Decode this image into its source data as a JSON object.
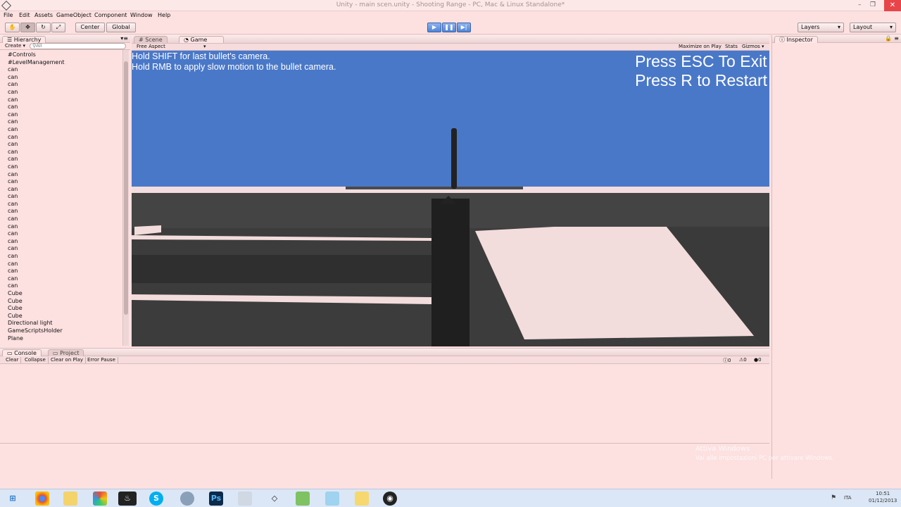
{
  "window": {
    "title": "Unity - main scen.unity - Shooting Range - PC, Mac & Linux Standalone*",
    "minimize": "–",
    "maximize": "❐",
    "close": "✕"
  },
  "menu": [
    "File",
    "Edit",
    "Assets",
    "GameObject",
    "Component",
    "Window",
    "Help"
  ],
  "toolbar": {
    "center_label": "Center",
    "global_label": "Global",
    "layers_label": "Layers",
    "layout_label": "Layout"
  },
  "hierarchy": {
    "tab": "Hierarchy",
    "create_label": "Create",
    "search_placeholder": "All",
    "items": [
      "#Controls",
      "#LevelManagement",
      "can",
      "can",
      "can",
      "can",
      "can",
      "can",
      "can",
      "can",
      "can",
      "can",
      "can",
      "can",
      "can",
      "can",
      "can",
      "can",
      "can",
      "can",
      "can",
      "can",
      "can",
      "can",
      "can",
      "can",
      "can",
      "can",
      "can",
      "can",
      "can",
      "can",
      "Cube",
      "Cube",
      "Cube",
      "Cube",
      "Directional light",
      "GameScriptsHolder",
      "Plane"
    ]
  },
  "center_tabs": {
    "scene": "Scene",
    "game": "Game"
  },
  "game_toolbar": {
    "aspect": "Free Aspect",
    "maximize_on_play": "Maximize on Play",
    "stats": "Stats",
    "gizmos": "Gizmos"
  },
  "game_overlay": {
    "line1": "Hold SHIFT for last bullet's camera.",
    "line2": "Hold RMB to apply slow motion to the bullet camera.",
    "right1": "Press ESC To Exit",
    "right2": "Press R to Restart"
  },
  "inspector": {
    "tab": "Inspector"
  },
  "console": {
    "tab_console": "Console",
    "tab_project": "Project",
    "buttons": [
      "Clear",
      "Collapse",
      "Clear on Play",
      "Error Pause"
    ],
    "counts": [
      "0",
      "0",
      "0"
    ]
  },
  "watermark": {
    "line1": "Attiva Windows",
    "line2": "Vai alle impostazioni PC per attivare Windows."
  },
  "taskbar": {
    "lang": "ITA",
    "time": "10:51",
    "date": "01/12/2013"
  },
  "colors": {
    "sky": "#4a78c8",
    "panel_bg": "#fde0e0",
    "ground_dark": "#3a3a3a",
    "ground_light": "#f2dada",
    "play_blue": "#4f84d6"
  }
}
